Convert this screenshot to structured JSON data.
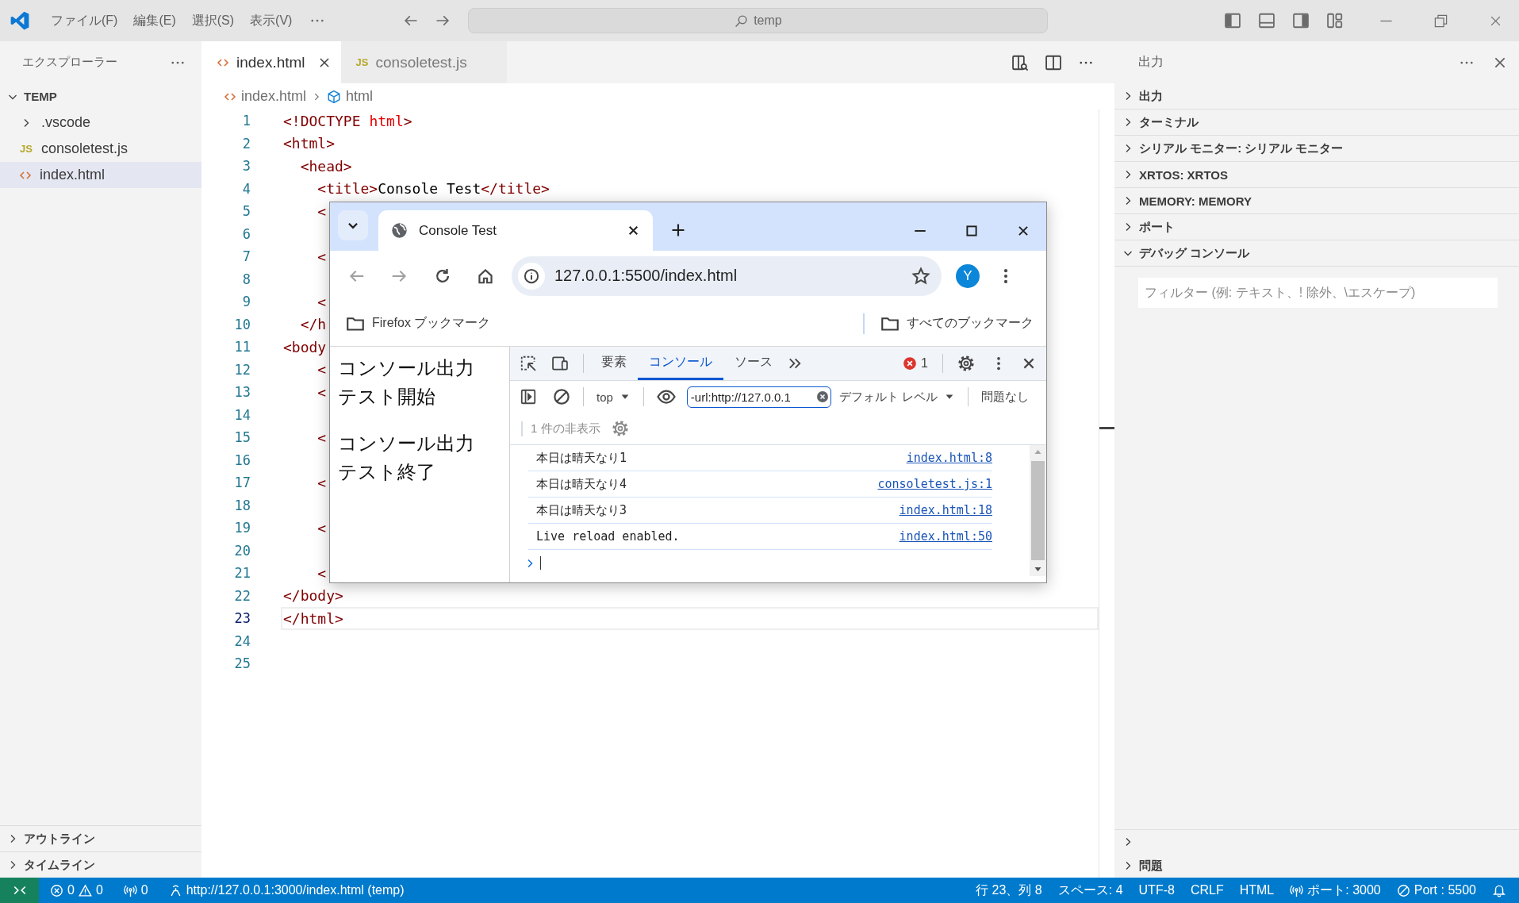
{
  "titlebar": {
    "menus": [
      "ファイル(F)",
      "編集(E)",
      "選択(S)",
      "表示(V)"
    ],
    "search": "temp"
  },
  "explorer": {
    "title": "エクスプローラー",
    "folder": {
      "name": "TEMP",
      "expanded": true,
      "children": [
        {
          "name": ".vscode",
          "kind": "folder",
          "expanded": false,
          "selected": false
        },
        {
          "name": "consoletest.js",
          "kind": "js",
          "icon_text": "JS",
          "selected": false
        },
        {
          "name": "index.html",
          "kind": "html",
          "selected": true
        }
      ]
    },
    "sections": [
      {
        "title": "アウトライン",
        "expanded": false
      },
      {
        "title": "タイムライン",
        "expanded": false
      }
    ]
  },
  "editor": {
    "tabs": [
      {
        "label": "index.html",
        "kind": "html",
        "selected": true
      },
      {
        "label": "consoletest.js",
        "kind": "js",
        "icon_text": "JS",
        "selected": false
      }
    ],
    "breadcrumb": [
      {
        "label": "index.html",
        "kind": "file"
      },
      {
        "label": "html",
        "kind": "element"
      }
    ],
    "lines": [
      {
        "number": "1",
        "current": false,
        "tokens": [
          {
            "text": "<!DOCTYPE ",
            "kind": "tag"
          },
          {
            "text": "html",
            "kind": "attr"
          },
          {
            "text": ">",
            "kind": "tag"
          }
        ]
      },
      {
        "number": "2",
        "current": false,
        "tokens": [
          {
            "text": "<html>",
            "kind": "tag"
          }
        ]
      },
      {
        "number": "3",
        "current": false,
        "tokens": [
          {
            "text": "  <head>",
            "kind": "tag"
          }
        ]
      },
      {
        "number": "4",
        "current": false,
        "tokens": [
          {
            "text": "    <title>",
            "kind": "tag"
          },
          {
            "text": "Console Test",
            "kind": "text"
          },
          {
            "text": "</title>",
            "kind": "tag"
          }
        ]
      },
      {
        "number": "5",
        "current": false,
        "tokens": [
          {
            "text": "    <",
            "kind": "tag"
          }
        ]
      },
      {
        "number": "6",
        "current": false
      },
      {
        "number": "7",
        "current": false,
        "tokens": [
          {
            "text": "    <",
            "kind": "tag"
          }
        ]
      },
      {
        "number": "8",
        "current": false
      },
      {
        "number": "9",
        "current": false,
        "tokens": [
          {
            "text": "    <",
            "kind": "tag"
          }
        ]
      },
      {
        "number": "10",
        "current": false,
        "tokens": [
          {
            "text": "  </h",
            "kind": "tag"
          }
        ]
      },
      {
        "number": "11",
        "current": false,
        "tokens": [
          {
            "text": "<body",
            "kind": "tag"
          }
        ]
      },
      {
        "number": "12",
        "current": false,
        "tokens": [
          {
            "text": "    <",
            "kind": "tag"
          }
        ]
      },
      {
        "number": "13",
        "current": false,
        "tokens": [
          {
            "text": "    <",
            "kind": "tag"
          }
        ]
      },
      {
        "number": "14",
        "current": false
      },
      {
        "number": "15",
        "current": false,
        "tokens": [
          {
            "text": "    <",
            "kind": "tag"
          }
        ]
      },
      {
        "number": "16",
        "current": false
      },
      {
        "number": "17",
        "current": false,
        "tokens": [
          {
            "text": "    <",
            "kind": "tag"
          }
        ]
      },
      {
        "number": "18",
        "current": false
      },
      {
        "number": "19",
        "current": false,
        "tokens": [
          {
            "text": "    <",
            "kind": "tag"
          }
        ]
      },
      {
        "number": "20",
        "current": false
      },
      {
        "number": "21",
        "current": false,
        "tokens": [
          {
            "text": "    <",
            "kind": "tag"
          }
        ]
      },
      {
        "number": "22",
        "current": false,
        "tokens": [
          {
            "text": "</body>",
            "kind": "tag"
          }
        ]
      },
      {
        "number": "23",
        "current": true,
        "tokens": [
          {
            "text": "</html>",
            "kind": "tag"
          }
        ]
      },
      {
        "number": "24",
        "current": false
      },
      {
        "number": "25",
        "current": false
      }
    ]
  },
  "browser": {
    "tabs": [
      {
        "title": "Console Test",
        "selected": true
      }
    ],
    "url": "127.0.0.1:5500/index.html",
    "avatar": "Y",
    "bookmarks": [
      {
        "label": "Firefox ブックマーク"
      }
    ],
    "all_bookmarks": "すべてのブックマーク",
    "page": {
      "paragraphs": [
        "コンソール出力テスト開始",
        "コンソール出力テスト終了"
      ]
    },
    "devtools": {
      "tabs": [
        {
          "label": "要素",
          "selected": false
        },
        {
          "label": "コンソール",
          "selected": true
        },
        {
          "label": "ソース",
          "selected": false
        }
      ],
      "error_count": "1",
      "context": "top",
      "filter": "-url:http://127.0.0.1",
      "level": "デフォルト レベル",
      "issues": "問題なし",
      "hidden_count": "1 件の非表示",
      "messages": [
        {
          "text": "本日は晴天なり1",
          "source": "index.html:8"
        },
        {
          "text": "本日は晴天なり4",
          "source": "consoletest.js:1"
        },
        {
          "text": "本日は晴天なり3",
          "source": "index.html:18"
        },
        {
          "text": "Live reload enabled.",
          "source": "index.html:50"
        }
      ]
    }
  },
  "panel": {
    "title": "出力",
    "sections": [
      {
        "title": "出力",
        "expanded": false
      },
      {
        "title": "ターミナル",
        "expanded": false
      },
      {
        "title": "シリアル モニター: シリアル モニター",
        "expanded": false
      },
      {
        "title": "XRTOS: XRTOS",
        "expanded": false
      },
      {
        "title": "MEMORY: MEMORY",
        "expanded": false
      },
      {
        "title": "ポート",
        "expanded": false
      },
      {
        "title": "デバッグ コンソール",
        "expanded": true
      }
    ],
    "filter_placeholder": "フィルター (例: テキスト、! 除外、\\エスケープ)",
    "bottom_sections": [
      {
        "expanded": false
      },
      {
        "title": "問題",
        "expanded": false
      }
    ]
  },
  "statusbar": {
    "left": [
      {
        "kind": "problems",
        "errors": "0",
        "warnings": "0"
      },
      {
        "kind": "ports",
        "text": "0"
      },
      {
        "kind": "live",
        "text": "http://127.0.0.1:3000/index.html (temp)"
      }
    ],
    "right": [
      {
        "kind": "plain",
        "text": "行 23、列 8"
      },
      {
        "kind": "plain",
        "text": "スペース: 4"
      },
      {
        "kind": "plain",
        "text": "UTF-8"
      },
      {
        "kind": "plain",
        "text": "CRLF"
      },
      {
        "kind": "plain",
        "text": "HTML"
      },
      {
        "kind": "ports",
        "text": "ポート: 3000"
      },
      {
        "kind": "blocked",
        "text": "Port : 5500"
      },
      {
        "kind": "bell"
      }
    ]
  }
}
